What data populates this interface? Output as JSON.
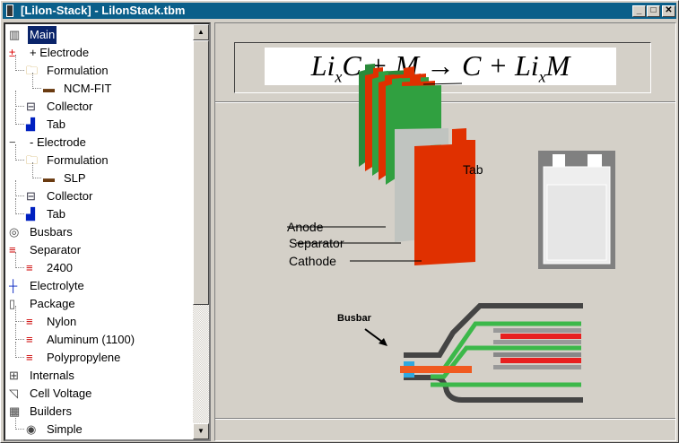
{
  "window": {
    "title": "[Lilon-Stack] - LilonStack.tbm",
    "minimize": "_",
    "maximize": "□",
    "close": "✕"
  },
  "tree": [
    {
      "label": "Main",
      "level": 0,
      "icon": "battery-stack-icon",
      "selected": true
    },
    {
      "label": "+ Electrode",
      "level": 0,
      "icon": "positive-electrode-icon"
    },
    {
      "label": "Formulation",
      "level": 1,
      "icon": "folder-icon"
    },
    {
      "label": "NCM-FIT",
      "level": 2,
      "icon": "material-icon"
    },
    {
      "label": "Collector",
      "level": 1,
      "icon": "collector-icon"
    },
    {
      "label": "Tab",
      "level": 1,
      "icon": "tab-icon"
    },
    {
      "label": "- Electrode",
      "level": 0,
      "icon": "negative-electrode-icon"
    },
    {
      "label": "Formulation",
      "level": 1,
      "icon": "folder-icon"
    },
    {
      "label": "SLP",
      "level": 2,
      "icon": "material-icon"
    },
    {
      "label": "Collector",
      "level": 1,
      "icon": "collector-icon"
    },
    {
      "label": "Tab",
      "level": 1,
      "icon": "tab-icon"
    },
    {
      "label": "Busbars",
      "level": 0,
      "icon": "busbar-icon"
    },
    {
      "label": "Separator",
      "level": 0,
      "icon": "layer-icon"
    },
    {
      "label": "2400",
      "level": 1,
      "icon": "layer-icon"
    },
    {
      "label": "Electrolyte",
      "level": 0,
      "icon": "electrolyte-icon"
    },
    {
      "label": "Package",
      "level": 0,
      "icon": "package-icon"
    },
    {
      "label": "Nylon",
      "level": 1,
      "icon": "layer-icon"
    },
    {
      "label": "Aluminum (1100)",
      "level": 1,
      "icon": "layer-icon"
    },
    {
      "label": "Polypropylene",
      "level": 1,
      "icon": "layer-icon"
    },
    {
      "label": "Internals",
      "level": 0,
      "icon": "internals-icon"
    },
    {
      "label": "Cell Voltage",
      "level": 0,
      "icon": "voltage-curve-icon"
    },
    {
      "label": "Builders",
      "level": 0,
      "icon": "builders-icon"
    },
    {
      "label": "Simple",
      "level": 1,
      "icon": "radio-icon"
    }
  ],
  "equation": {
    "a": "Li",
    "x": "x",
    "b": "C + M → C + Li",
    "c": "M"
  },
  "diagram": {
    "tab": "Tab",
    "anode": "Anode",
    "separator": "Separator",
    "cathode": "Cathode",
    "busbar": "Busbar"
  },
  "colors": {
    "titlebar": "#0a5f8a",
    "cathode": "#e03000",
    "anode": "#30a040",
    "separator": "#c0c4c0"
  }
}
